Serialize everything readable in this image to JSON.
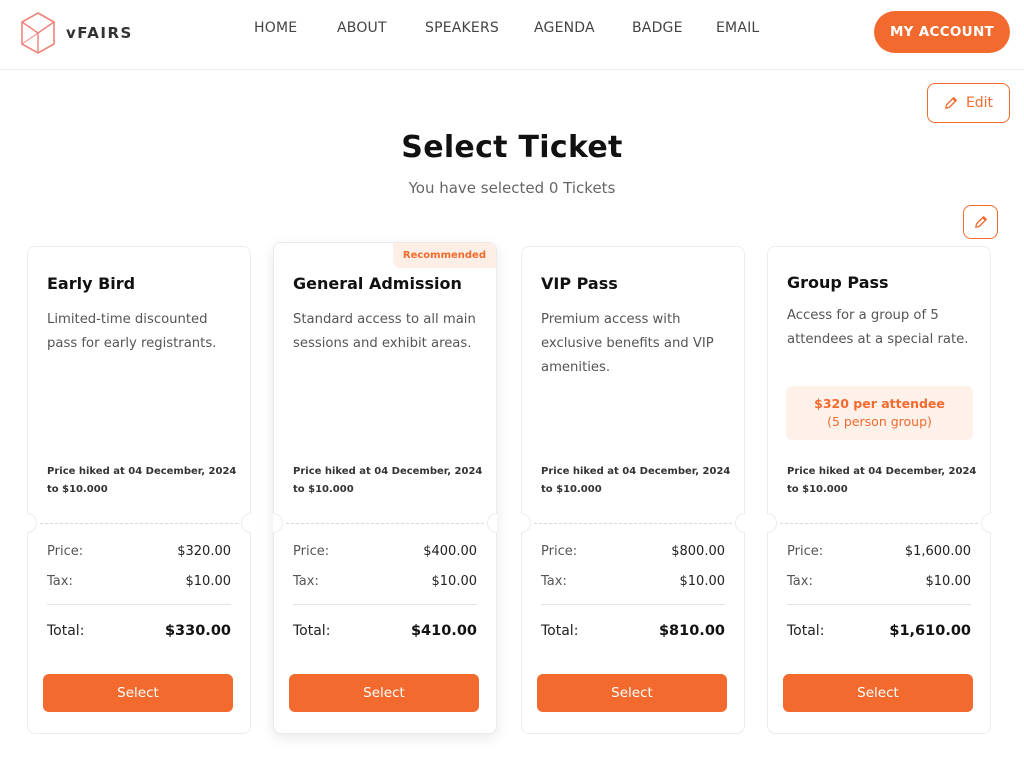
{
  "brand": {
    "name": "vFAIRS",
    "accent": "#f26a2e"
  },
  "nav": [
    {
      "label": "HOME"
    },
    {
      "label": "ABOUT"
    },
    {
      "label": "SPEAKERS"
    },
    {
      "label": "AGENDA"
    },
    {
      "label": "BADGE"
    },
    {
      "label": "EMAIL"
    }
  ],
  "header": {
    "account_label": "MY ACCOUNT"
  },
  "edit": {
    "label": "Edit",
    "icon": "pencil-icon"
  },
  "page": {
    "title": "Select Ticket",
    "subtitle": "You have selected 0 Tickets"
  },
  "labels": {
    "price": "Price:",
    "tax": "Tax:",
    "total": "Total:",
    "select": "Select"
  },
  "tickets": [
    {
      "title": "Early Bird",
      "description": "Limited-time discounted pass for early registrants.",
      "hike_note": "Price hiked at 04 December, 2024 to $10.000",
      "price": "$320.00",
      "tax": "$10.00",
      "total": "$330.00"
    },
    {
      "title": "General Admission",
      "badge": "Recommended",
      "description": "Standard access to all main sessions and exhibit areas.",
      "hike_note": "Price hiked at 04 December, 2024 to $10.000",
      "price": "$400.00",
      "tax": "$10.00",
      "total": "$410.00"
    },
    {
      "title": "VIP Pass",
      "description": "Premium access with exclusive benefits and VIP amenities.",
      "hike_note": "Price hiked at 04 December, 2024 to $10.000",
      "price": "$800.00",
      "tax": "$10.00",
      "total": "$810.00"
    },
    {
      "title": "Group Pass",
      "description": "Access for a group of 5 attendees at a special rate.",
      "promo_line1": "$320 per attendee",
      "promo_line2": "(5 person group)",
      "hike_note": "Price hiked at 04 December, 2024 to $10.000",
      "price": "$1,600.00",
      "tax": "$10.00",
      "total": "$1,610.00"
    }
  ]
}
